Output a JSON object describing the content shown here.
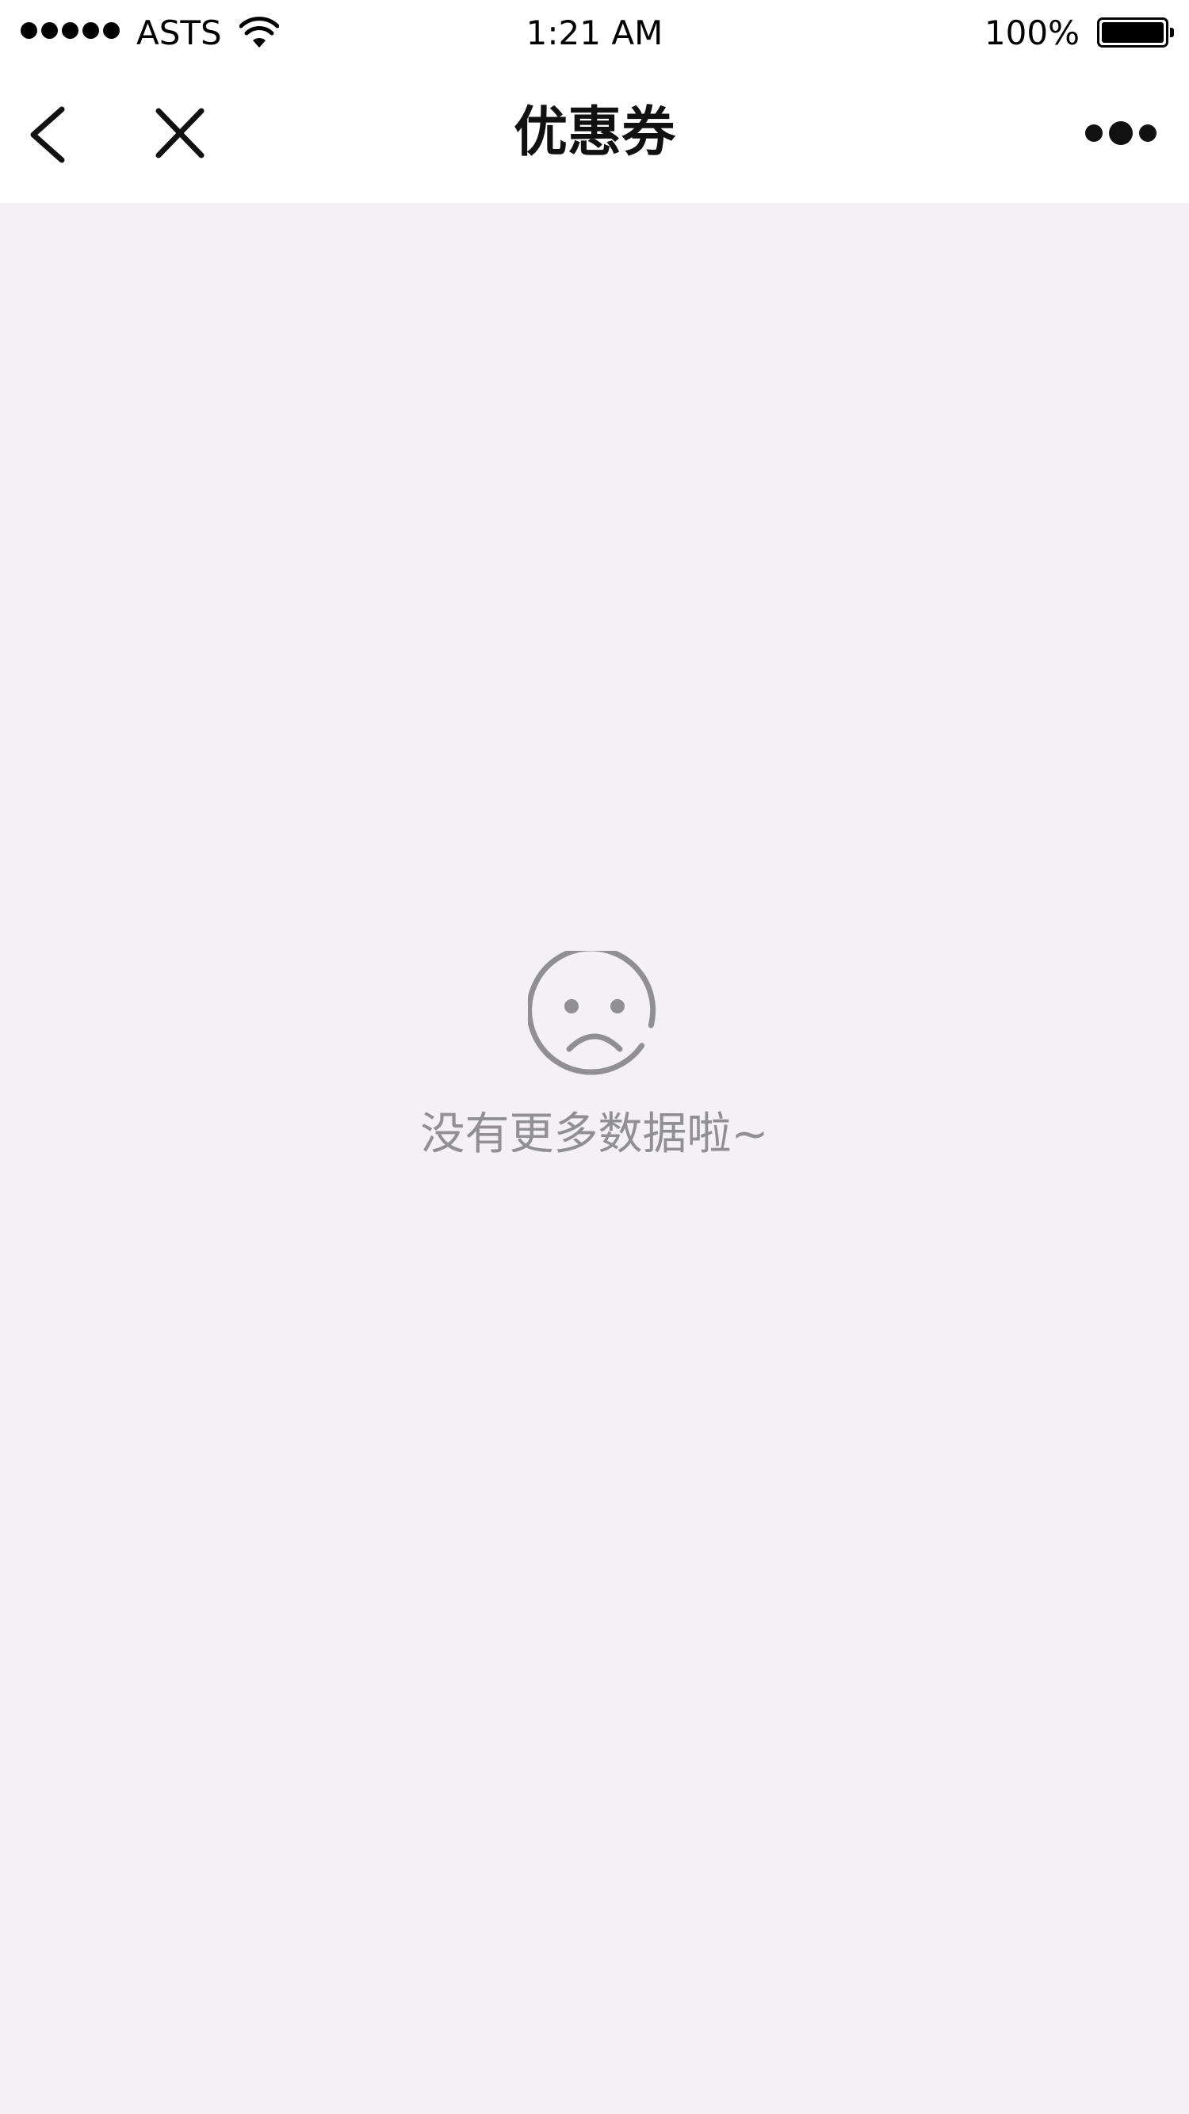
{
  "status_bar": {
    "carrier": "ASTS",
    "time": "1:21 AM",
    "battery_percent": "100%",
    "signal_bars": 5,
    "battery_level": 1.0
  },
  "nav_bar": {
    "title": "优惠券",
    "back_icon": "chevron-left-icon",
    "close_icon": "close-icon",
    "more_icon": "more-icon"
  },
  "empty_state": {
    "icon": "sad-face-icon",
    "message": "没有更多数据啦~"
  },
  "colors": {
    "page_background": "#f4f1f6",
    "bar_background": "#ffffff",
    "empty_text": "#8f8f94"
  }
}
